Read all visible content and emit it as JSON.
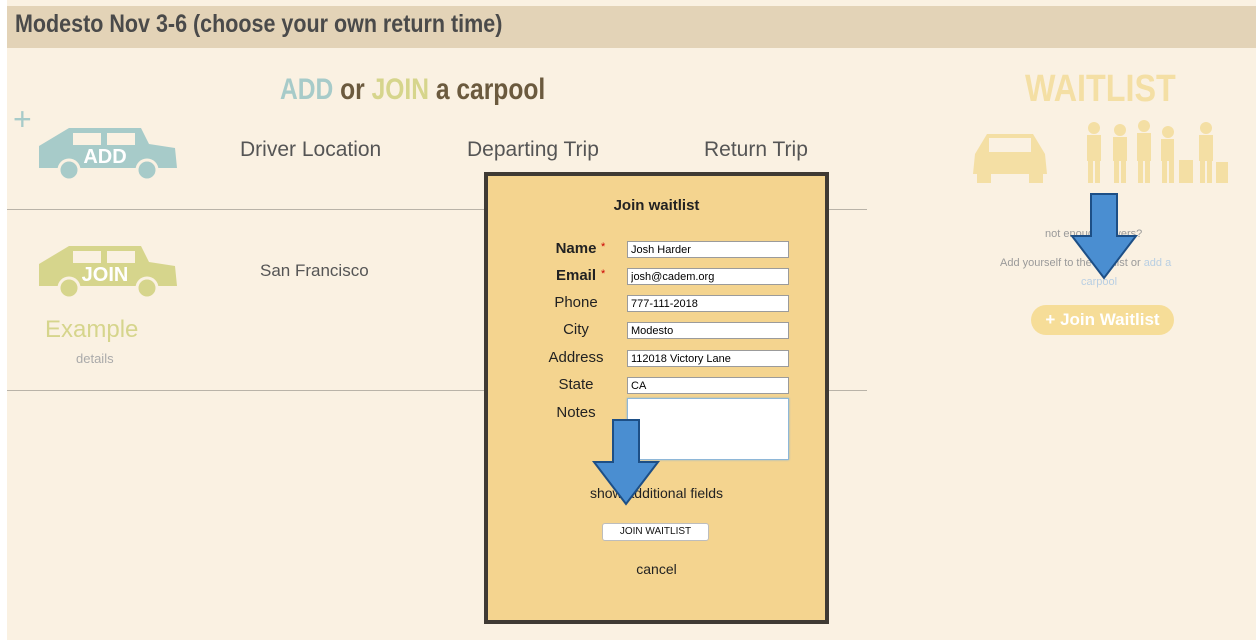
{
  "page": {
    "title": "Modesto Nov 3-6 (choose your own return time)"
  },
  "carpool": {
    "heading_add": "ADD",
    "heading_or": "or",
    "heading_join": "JOIN",
    "heading_rest": "a carpool",
    "add_car_label": "ADD",
    "columns": [
      "Driver Location",
      "Departing Trip",
      "Return Trip"
    ],
    "example_row": {
      "car_label": "JOIN",
      "example_text": "Example",
      "details_link": "details",
      "driver_location": "San Francisco"
    }
  },
  "waitlist": {
    "heading": "WAITLIST",
    "line1": "not enough drivers?",
    "line2_prefix": "Add yourself to the waitlist or",
    "line2_link": "add a",
    "line3_link": "carpool",
    "join_button": "+ Join Waitlist"
  },
  "modal": {
    "title": "Join waitlist",
    "fields": [
      {
        "label": "Name",
        "value": "Josh Harder",
        "required": true
      },
      {
        "label": "Email",
        "value": "josh@cadem.org",
        "required": true
      },
      {
        "label": "Phone",
        "value": "777-111-2018",
        "required": false
      },
      {
        "label": "City",
        "value": "Modesto",
        "required": false
      },
      {
        "label": "Address",
        "value": "112018 Victory Lane",
        "required": false
      },
      {
        "label": "State",
        "value": "CA",
        "required": false
      }
    ],
    "notes_label": "Notes",
    "notes_value": "",
    "required_marker": "*",
    "show_fields_link": "show additional fields",
    "submit_button": "JOIN WAITLIST",
    "cancel_link": "cancel"
  },
  "colors": {
    "title_bar": "#e3d3b7",
    "background": "#faf1e2",
    "add_accent": "#a7cbc9",
    "join_accent": "#d6d58c",
    "waitlist_accent": "#f6dd98",
    "modal_bg": "#f4d48f",
    "arrow": "#4a8ed1"
  },
  "icons": [
    "plus-icon",
    "add-car-icon",
    "join-car-icon",
    "waitlist-car-icon",
    "waitlist-people-icon",
    "arrow-down-icon"
  ]
}
